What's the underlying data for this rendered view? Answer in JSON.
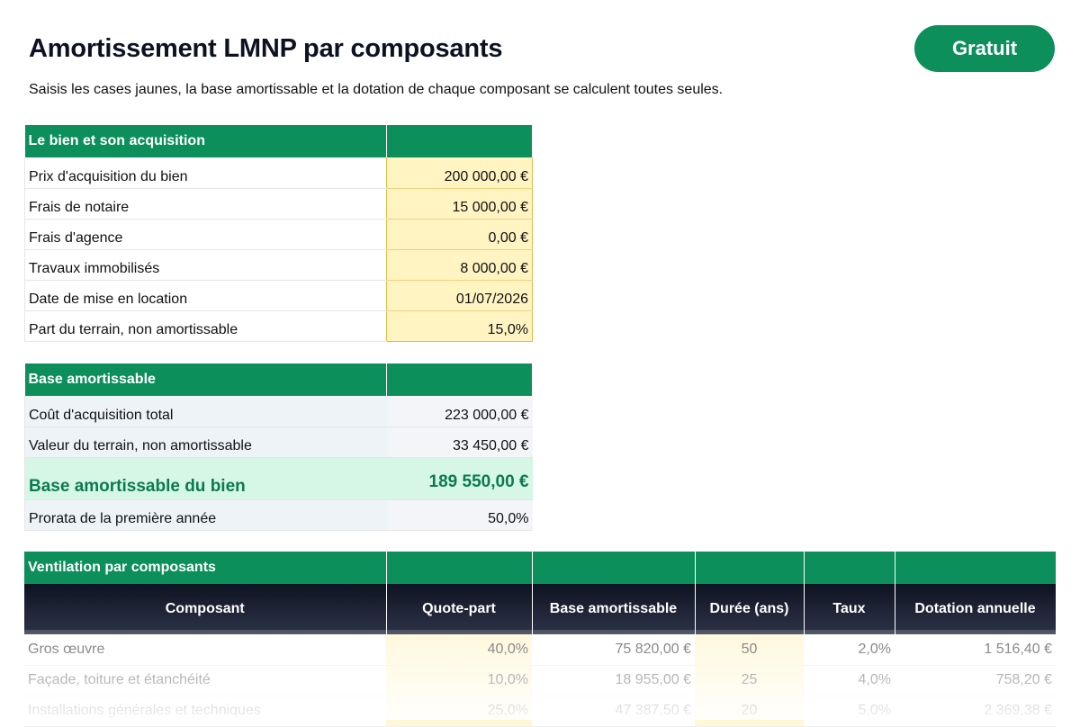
{
  "header": {
    "title": "Amortissement LMNP par composants",
    "subtitle": "Saisis les cases jaunes, la base amortissable et la dotation de chaque composant se calculent toutes seules.",
    "badge": "Gratuit"
  },
  "acquisition": {
    "title": "Le bien et son acquisition",
    "rows": [
      {
        "label": "Prix d'acquisition du bien",
        "value": "200 000,00 €"
      },
      {
        "label": "Frais de notaire",
        "value": "15 000,00 €"
      },
      {
        "label": "Frais d'agence",
        "value": "0,00 €"
      },
      {
        "label": "Travaux immobilisés",
        "value": "8 000,00 €"
      },
      {
        "label": "Date de mise en location",
        "value": "01/07/2026"
      },
      {
        "label": "Part du terrain, non amortissable",
        "value": "15,0%"
      }
    ]
  },
  "base": {
    "title": "Base amortissable",
    "rows": [
      {
        "label": "Coût d'acquisition total",
        "value": "223 000,00 €"
      },
      {
        "label": "Valeur du terrain, non amortissable",
        "value": "33 450,00 €"
      }
    ],
    "highlight": {
      "label": "Base amortissable du bien",
      "value": "189 550,00 €"
    },
    "prorata": {
      "label": "Prorata de la première année",
      "value": "50,0%"
    }
  },
  "components": {
    "title": "Ventilation par composants",
    "columns": [
      "Composant",
      "Quote-part",
      "Base amortissable",
      "Durée (ans)",
      "Taux",
      "Dotation annuelle"
    ],
    "rows": [
      {
        "name": "Gros œuvre",
        "share": "40,0%",
        "base": "75 820,00 €",
        "duration": "50",
        "rate": "2,0%",
        "dotation": "1 516,40 €"
      },
      {
        "name": "Façade, toiture et étanchéité",
        "share": "10,0%",
        "base": "18 955,00 €",
        "duration": "25",
        "rate": "4,0%",
        "dotation": "758,20 €"
      },
      {
        "name": "Installations générales et techniques",
        "share": "25,0%",
        "base": "47 387,50 €",
        "duration": "20",
        "rate": "5,0%",
        "dotation": "2 369,38 €"
      }
    ]
  }
}
